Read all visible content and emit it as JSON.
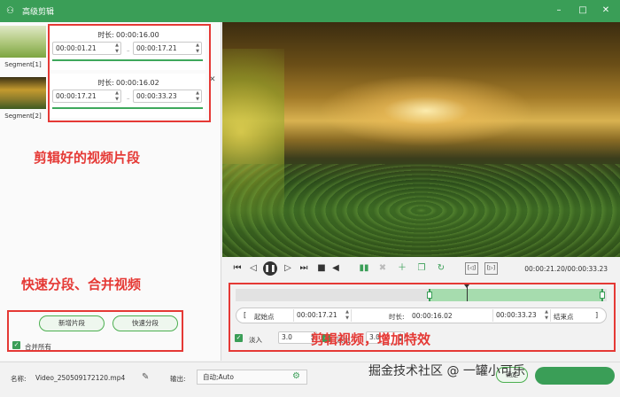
{
  "titlebar": {
    "title": "高级剪辑",
    "icon": "app-logo-icon",
    "minimize": "–",
    "maximize": "□",
    "close": "✕"
  },
  "segments": [
    {
      "label": "Segment[1]",
      "duration_label": "时长:",
      "duration": "00:00:16.00",
      "start": "00:00:01.21",
      "end": "00:00:17.21"
    },
    {
      "label": "Segment[2]",
      "duration_label": "时长:",
      "duration": "00:00:16.02",
      "start": "00:00:17.21",
      "end": "00:00:33.23"
    }
  ],
  "annotations": {
    "clips": "剪辑好的视频片段",
    "split_merge": "快速分段、合并视频",
    "edit": "剪辑视频，增加特效"
  },
  "left_buttons": {
    "add_segment": "新增片段",
    "quick_split": "快速分段",
    "merge_all": "合并所有",
    "merge_all_checked": true
  },
  "controls": {
    "timecode": "00:00:21.20/00:00:33.23",
    "frame_left": "[◁]",
    "frame_right": "[▷]"
  },
  "timeline": {
    "selection_start_fraction": 0.52,
    "selection_end_fraction": 1.0,
    "playhead_fraction": 0.623
  },
  "range": {
    "start_label": "起始点",
    "start_value": "00:00:17.21",
    "duration_label": "时长:",
    "duration_value": "00:00:16.02",
    "end_value": "00:00:33.23",
    "end_label": "结束点",
    "open_bracket": "[",
    "close_bracket": "]"
  },
  "fade": {
    "fade_in_label": "淡入",
    "fade_in_value": "3.0",
    "fade_in_checked": true,
    "fade_out_label": "淡出",
    "fade_out_value": "3.0",
    "fade_out_checked": true
  },
  "bottom": {
    "name_label": "名称:",
    "name_value": "Video_250509172120.mp4",
    "output_label": "输出:",
    "output_value": "自动;Auto",
    "watermark": "掘金技术社区 @ 一罐小可乐",
    "ok_label": "确定"
  },
  "colors": {
    "brand": "#3a9e57",
    "annotation": "#e53935"
  }
}
